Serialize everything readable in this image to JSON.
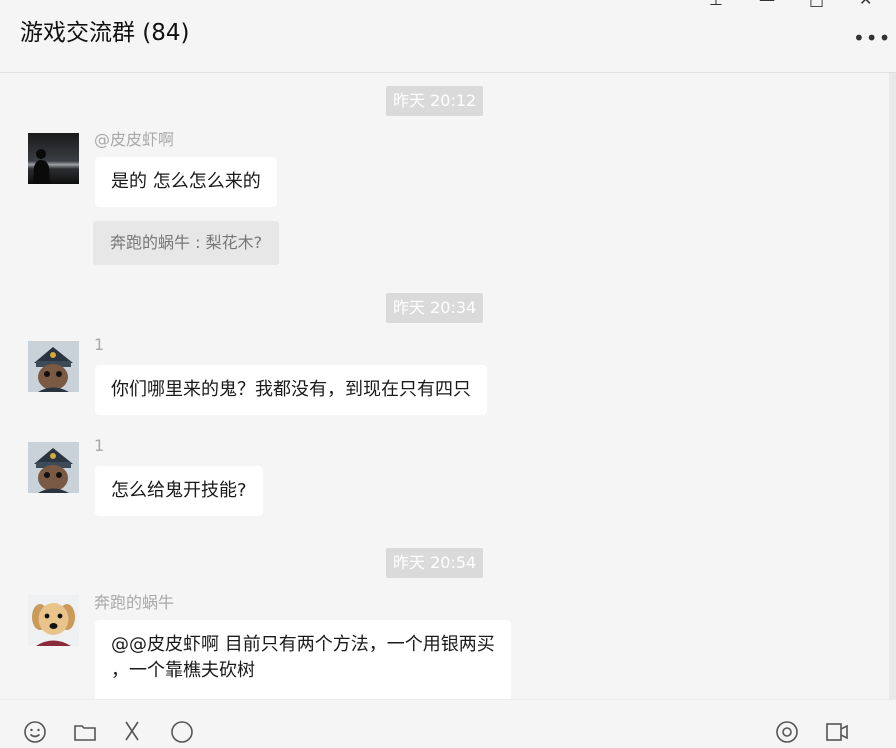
{
  "window": {
    "title": "游戏交流群 (84)",
    "pin_glyph": "⊥",
    "minimize_glyph": "—",
    "maximize_glyph": "□",
    "close_glyph": "✕",
    "more_glyph": "•••"
  },
  "messages": {
    "t1": "昨天 20:12",
    "m1_sender": "@皮皮虾啊",
    "m1_text": "是的 怎么怎么来的",
    "m1_quote": "奔跑的蜗牛 : 梨花木?",
    "t2": "昨天 20:34",
    "m2_sender": "1",
    "m2_text": "你们哪里来的鬼？我都没有，到现在只有四只",
    "m3_sender": "1",
    "m3_text": "怎么给鬼开技能?",
    "t3": "昨天 20:54",
    "m4_sender": "奔跑的蜗牛",
    "m4_line1": "@@皮皮虾啊 目前只有两个方法，一个用银两买",
    "m4_line2": "，一个靠樵夫砍树"
  },
  "icons": {
    "avatar1": "silhouette-avatar",
    "avatar2": "cartoon-warrior-avatar",
    "avatar3": "puppy-avatar",
    "tool1": "emoji-icon",
    "tool2": "folder-icon",
    "tool3": "scissors-icon",
    "tool4": "chat-bubble-icon",
    "tool5": "video-call-icon",
    "tool6": "phone-icon"
  }
}
